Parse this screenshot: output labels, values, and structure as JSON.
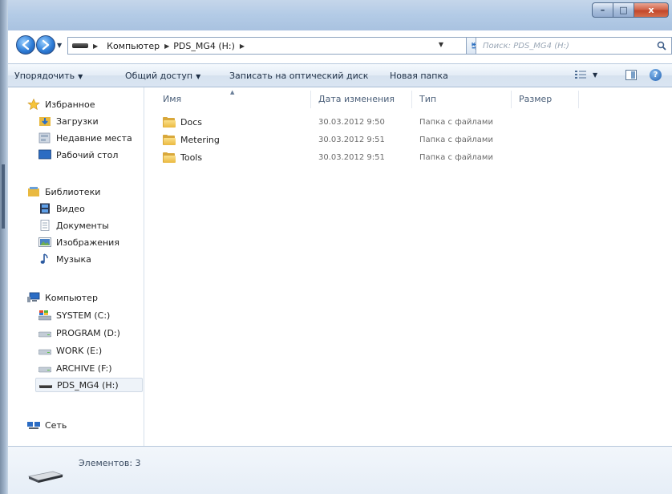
{
  "window": {
    "caption_buttons": {
      "minimize": "–",
      "maximize": "□",
      "close": "x"
    }
  },
  "address": {
    "breadcrumbs": [
      "Компьютер",
      "PDS_MG4 (H:)"
    ],
    "search_placeholder": "Поиск: PDS_MG4 (H:)"
  },
  "toolbar": {
    "organize": "Упорядочить",
    "share": "Общий доступ",
    "burn": "Записать на оптический диск",
    "new_folder": "Новая папка"
  },
  "nav": {
    "favorites": {
      "label": "Избранное",
      "items": [
        "Загрузки",
        "Недавние места",
        "Рабочий стол"
      ]
    },
    "libraries": {
      "label": "Библиотеки",
      "items": [
        "Видео",
        "Документы",
        "Изображения",
        "Музыка"
      ]
    },
    "computer": {
      "label": "Компьютер",
      "items": [
        "SYSTEM (C:)",
        "PROGRAM (D:)",
        "WORK (E:)",
        "ARCHIVE (F:)",
        "PDS_MG4 (H:)"
      ],
      "selected": "PDS_MG4 (H:)"
    },
    "network": {
      "label": "Сеть"
    }
  },
  "columns": {
    "name": "Имя",
    "date": "Дата изменения",
    "type": "Тип",
    "size": "Размер"
  },
  "files": [
    {
      "name": "Docs",
      "date": "30.03.2012 9:50",
      "type": "Папка с файлами",
      "icon": "folder-icon"
    },
    {
      "name": "Metering",
      "date": "30.03.2012 9:51",
      "type": "Папка с файлами",
      "icon": "folder-icon"
    },
    {
      "name": "Tools",
      "date": "30.03.2012 9:51",
      "type": "Папка с файлами",
      "icon": "folder-icon"
    }
  ],
  "status": {
    "items_count": "Элементов: 3"
  },
  "colors": {
    "titlebar": "#b3cbe6",
    "close_button": "#c2472a",
    "nav_button": "#2f7ed8",
    "folder": "#eab940",
    "selection": "#eef3f9"
  }
}
